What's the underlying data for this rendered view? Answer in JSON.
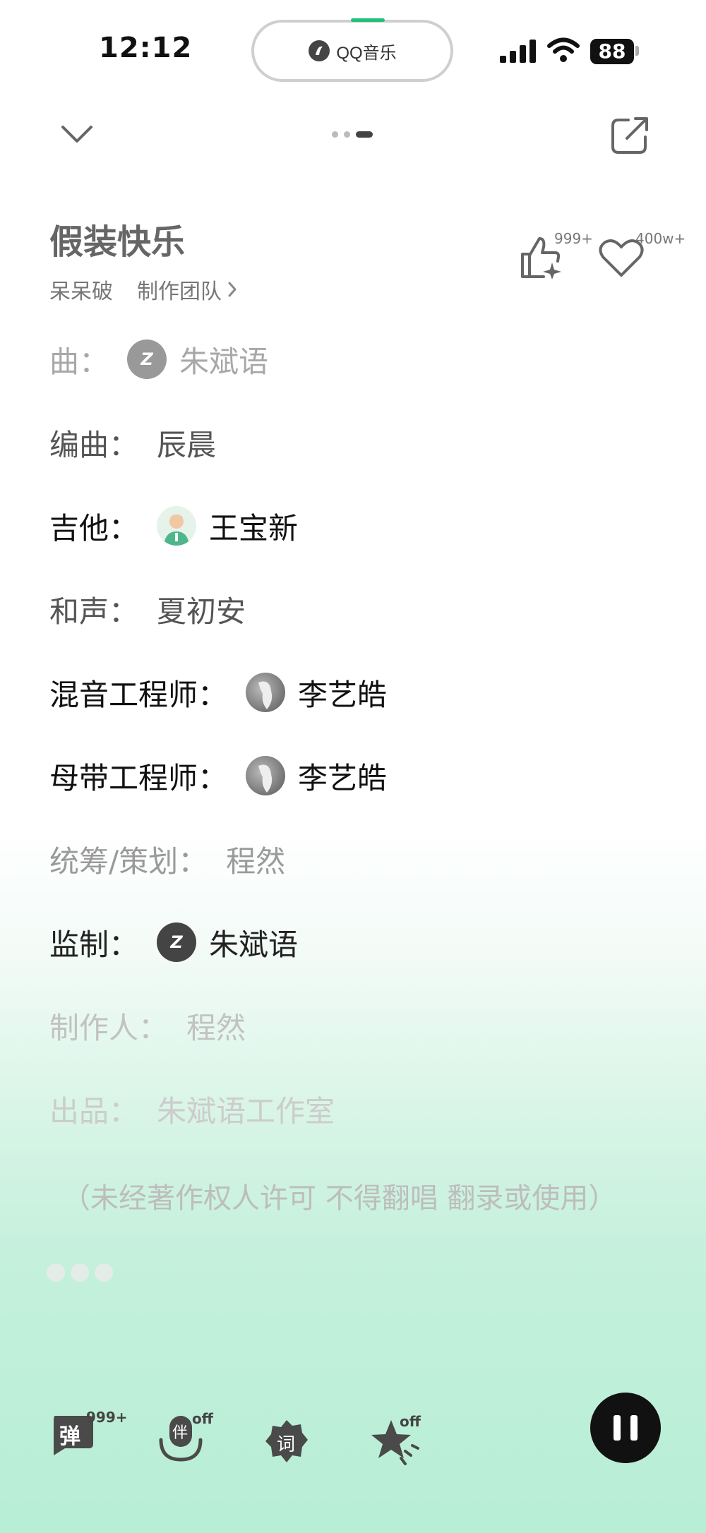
{
  "status_bar": {
    "time": "12:12",
    "island_app": "QQ音乐",
    "battery": "88"
  },
  "song": {
    "title": "假装快乐",
    "artist": "呆呆破",
    "team_label": "制作团队",
    "likes_count": "999+",
    "favorites_count": "400w+"
  },
  "credits": [
    {
      "role": "曲：",
      "name": "朱斌语",
      "avatar": "z-logo-avatar",
      "color": "#a8a8a8"
    },
    {
      "role": "编曲：",
      "name": "辰晨",
      "avatar": "",
      "color": "#555555"
    },
    {
      "role": "吉他：",
      "name": "王宝新",
      "avatar": "person-avatar",
      "color": "#111111"
    },
    {
      "role": "和声：",
      "name": "夏初安",
      "avatar": "",
      "color": "#555555"
    },
    {
      "role": "混音工程师：",
      "name": "李艺皓",
      "avatar": "bird-avatar",
      "color": "#111111"
    },
    {
      "role": "母带工程师：",
      "name": "李艺皓",
      "avatar": "bird-avatar",
      "color": "#111111"
    },
    {
      "role": "统筹/策划：",
      "name": "程然",
      "avatar": "",
      "color": "#9a9a9a"
    },
    {
      "role": "监制：",
      "name": "朱斌语",
      "avatar": "z-logo-avatar",
      "color": "#222222"
    },
    {
      "role": "制作人：",
      "name": "程然",
      "avatar": "",
      "color": "#c2c2c2"
    },
    {
      "role": "出品：",
      "name": "朱斌语工作室",
      "avatar": "",
      "color": "#cccccc"
    }
  ],
  "notice": "（未经著作权人许可 不得翻唱 翻录或使用）",
  "toolbar": {
    "danmu_label": "弹",
    "danmu_count": "999+",
    "accompany_label": "伴",
    "accompany_state": "off",
    "lyrics_label": "词",
    "effects_state": "off"
  },
  "colors": {
    "accent": "#20c07b",
    "background_bottom": "#b8eed5"
  }
}
